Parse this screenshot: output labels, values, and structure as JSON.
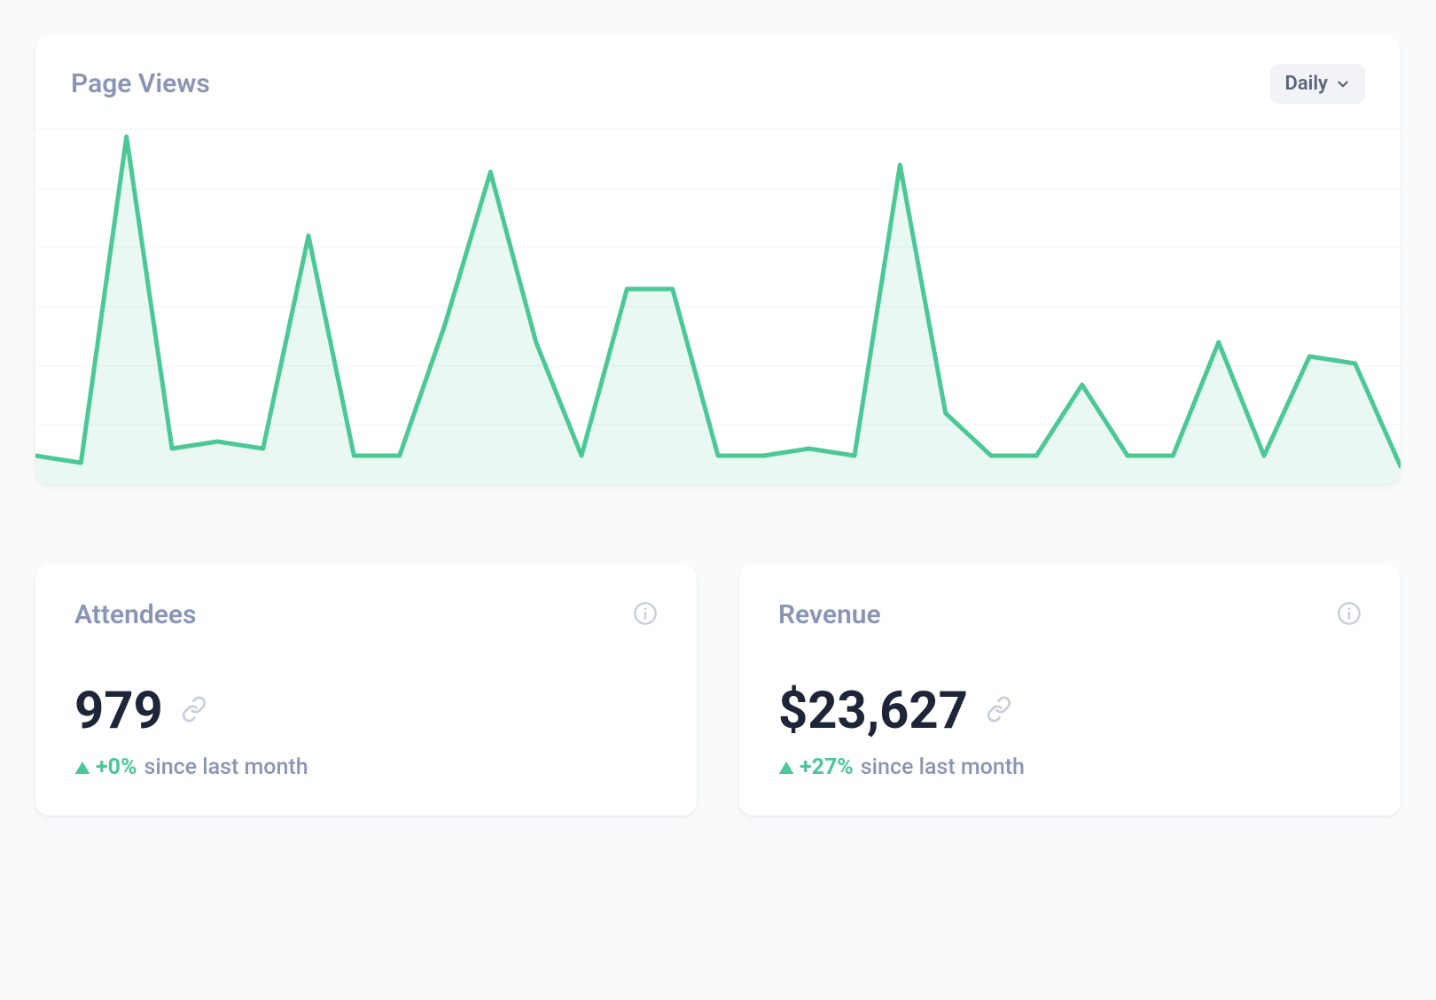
{
  "pageViews": {
    "title": "Page Views",
    "periodSelector": {
      "selected": "Daily"
    }
  },
  "chart_data": {
    "type": "area",
    "title": "Page Views",
    "xlabel": "",
    "ylabel": "",
    "ylim": [
      0,
      100
    ],
    "x": [
      0,
      1,
      2,
      3,
      4,
      5,
      6,
      7,
      8,
      9,
      10,
      11,
      12,
      13,
      14,
      15,
      16,
      17,
      18,
      19,
      20,
      21,
      22,
      23,
      24,
      25,
      26,
      27,
      28,
      29,
      30
    ],
    "values": [
      8,
      6,
      98,
      10,
      12,
      10,
      70,
      8,
      8,
      45,
      88,
      40,
      8,
      55,
      55,
      8,
      8,
      10,
      8,
      90,
      20,
      8,
      8,
      28,
      8,
      8,
      40,
      8,
      36,
      34,
      5
    ]
  },
  "stats": {
    "attendees": {
      "label": "Attendees",
      "value": "979",
      "change": "+0%",
      "period": "since last month"
    },
    "revenue": {
      "label": "Revenue",
      "value": "$23,627",
      "change": "+27%",
      "period": "since last month"
    }
  }
}
